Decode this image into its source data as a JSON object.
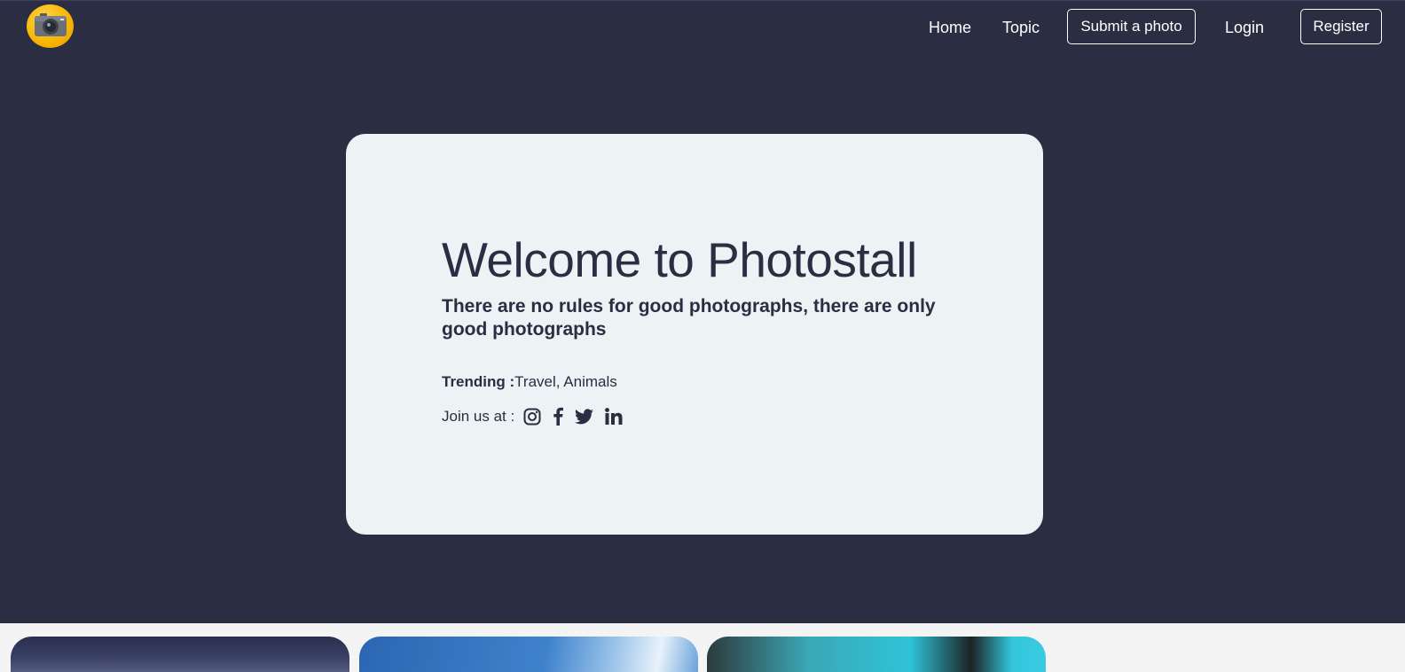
{
  "nav": {
    "logo_icon": "camera-icon",
    "home": "Home",
    "topic": "Topic",
    "submit": "Submit a photo",
    "login": "Login",
    "register": "Register"
  },
  "hero": {
    "title": "Welcome to Photostall",
    "subtitle": "There are no rules for good photographs, there are only good photographs",
    "trending_label": "Trending :",
    "trending_value": "Travel, Animals",
    "join_label": "Join us at :",
    "social_icons": [
      "instagram-icon",
      "facebook-icon",
      "twitter-icon",
      "linkedin-icon"
    ]
  },
  "colors": {
    "hero_bg": "#2b2d42",
    "card_bg": "#edf2f4",
    "text_dark": "#2b2d42",
    "logo_accent": "#f7b500"
  }
}
